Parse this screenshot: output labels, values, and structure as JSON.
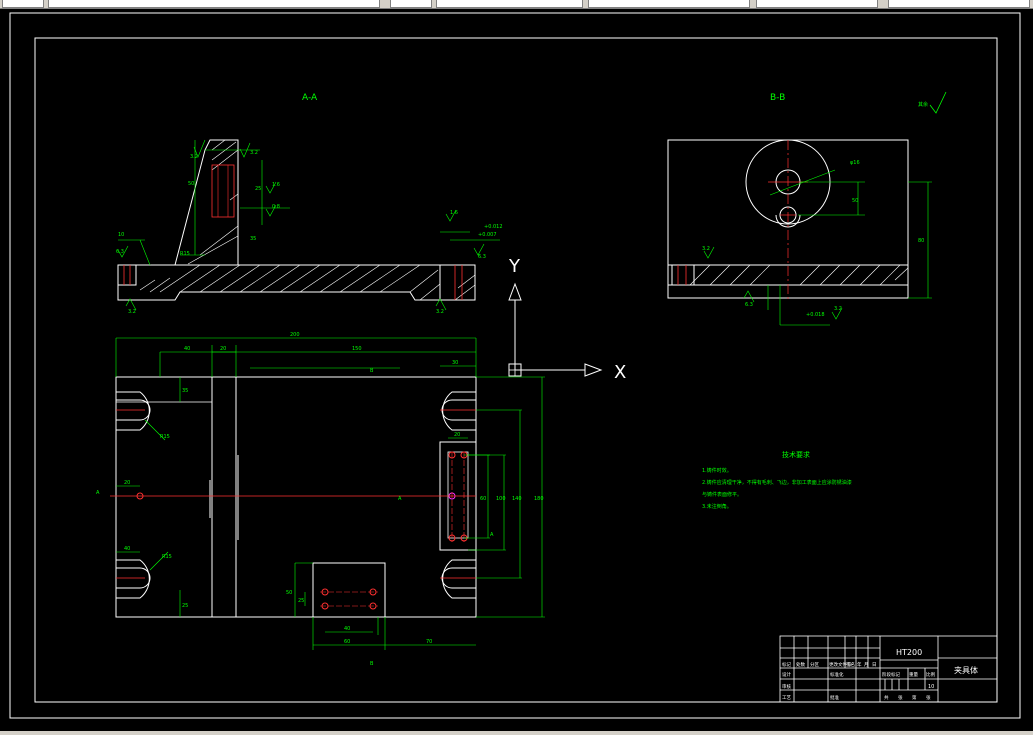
{
  "title_block": {
    "material": "HT200",
    "part_name": "夹具体",
    "scale_value": "10",
    "row_labels": [
      "标记",
      "设计",
      "审核",
      "工艺"
    ],
    "col_labels": [
      "处数",
      "分区",
      "更改文件号",
      "签名",
      "年",
      "月",
      "日"
    ],
    "mid_labels": [
      "标准化",
      "批准"
    ],
    "right_labels": [
      "阶段标记",
      "重量",
      "比例"
    ],
    "bottom_labels": [
      "共",
      "张",
      "第",
      "张"
    ]
  },
  "views": {
    "section_a_label": "A-A",
    "section_b_label": "B-B",
    "view_a_marker": "A",
    "view_b_marker": "B",
    "roughness_top_right": "其余"
  },
  "tech_req": {
    "title": "技术要求",
    "items": [
      "1.铸件时效。",
      "2.铸件应清理干净，不得有毛刺、飞边，非加工表面上应涂防锈油漆",
      "与铸件表面修平。",
      "3.未注倒角。"
    ]
  },
  "ucs": {
    "x_label": "X",
    "y_label": "Y"
  },
  "dims": {
    "overall_width": "200",
    "left_40": "40",
    "mid_20": "20",
    "inner_150": "150",
    "right_30": "30",
    "height_180": "180",
    "h_140": "140",
    "h_100": "100",
    "dim_20a": "20",
    "dim_20b": "20",
    "dim_40": "40",
    "dim_60": "60",
    "dim_70": "70",
    "dim_35": "35",
    "dim_25": "25",
    "r_label": "R15",
    "r_label2": "R15",
    "dim_10": "10",
    "dim_50": "50",
    "phi_label": "φ16",
    "b_80": "80",
    "b_50": "50",
    "tol1": "+0.018",
    "tol2": "+0.007",
    "tol3": "+0.012"
  },
  "roughness": {
    "r32": "3.2",
    "r16": "1.6",
    "r08": "0.8",
    "r63": "6.3"
  }
}
